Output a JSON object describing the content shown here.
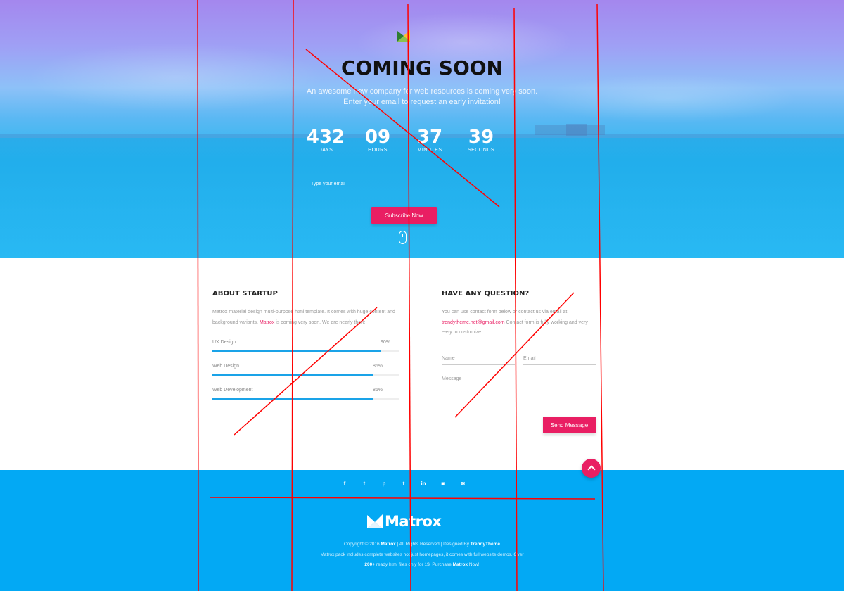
{
  "hero": {
    "title": "COMING SOON",
    "subtitle_line1": "An awesome new company for web resources is coming very soon.",
    "subtitle_line2": "Enter your email to request an early invitation!",
    "countdown": [
      {
        "value": "432",
        "label": "DAYS"
      },
      {
        "value": "09",
        "label": "HOURS"
      },
      {
        "value": "37",
        "label": "MINUTES"
      },
      {
        "value": "39",
        "label": "SECONDS"
      }
    ],
    "email_placeholder": "Type your email",
    "subscribe_label": "Subscribe Now",
    "icons": {
      "logo": "matrox-logo-icon",
      "scroll": "scroll-mouse-icon"
    }
  },
  "about": {
    "title": "ABOUT STARTUP",
    "text_before": "Matrox material design multi-purpose html template. It comes with huge content and background variants. ",
    "text_highlight": "Matrox",
    "text_after": " is coming very soon. We are nearly there.",
    "skills": [
      {
        "name": "UX Design",
        "percent_label": "90%",
        "value": 0.9
      },
      {
        "name": "Web Design",
        "percent_label": "86%",
        "value": 0.86
      },
      {
        "name": "Web Development",
        "percent_label": "86%",
        "value": 0.86
      }
    ]
  },
  "contact": {
    "title": "HAVE ANY QUESTION?",
    "text_before": "You can use contact form below or contact us via email at",
    "email": "trendytheme.net@gmail.com",
    "text_after": " Contact form is fully working and very easy to customize.",
    "name_placeholder": "Name",
    "email_placeholder": "Email",
    "message_placeholder": "Message",
    "send_label": "Send Message"
  },
  "footer": {
    "social_icons": [
      {
        "name": "facebook-icon",
        "glyph": "f"
      },
      {
        "name": "twitter-icon",
        "glyph": "t"
      },
      {
        "name": "pinterest-icon",
        "glyph": "p"
      },
      {
        "name": "tumblr-icon",
        "glyph": "t"
      },
      {
        "name": "linkedin-icon",
        "glyph": "in"
      },
      {
        "name": "instagram-icon",
        "glyph": "◙"
      },
      {
        "name": "rss-icon",
        "glyph": "≋"
      }
    ],
    "logo_text": "Matrox",
    "copyright_prefix": "Copyright © 2016 ",
    "copyright_brand": "Matrox",
    "rights": "  |  All Rights Reserved  |  Designed By ",
    "designer": "TrendyTheme",
    "line2": "Matrox pack includes complete websites not just homepages, it comes with full website demos. Over",
    "line3_count": "200+",
    "line3_mid": " ready html files only for 1$. Purchase ",
    "line3_brand": "Matrox",
    "line3_end": " Now!"
  },
  "colors": {
    "accent": "#e91e63",
    "footer_bg": "#03a9f4",
    "progress": "#1aa3e8",
    "annotation": "#ff0000"
  }
}
